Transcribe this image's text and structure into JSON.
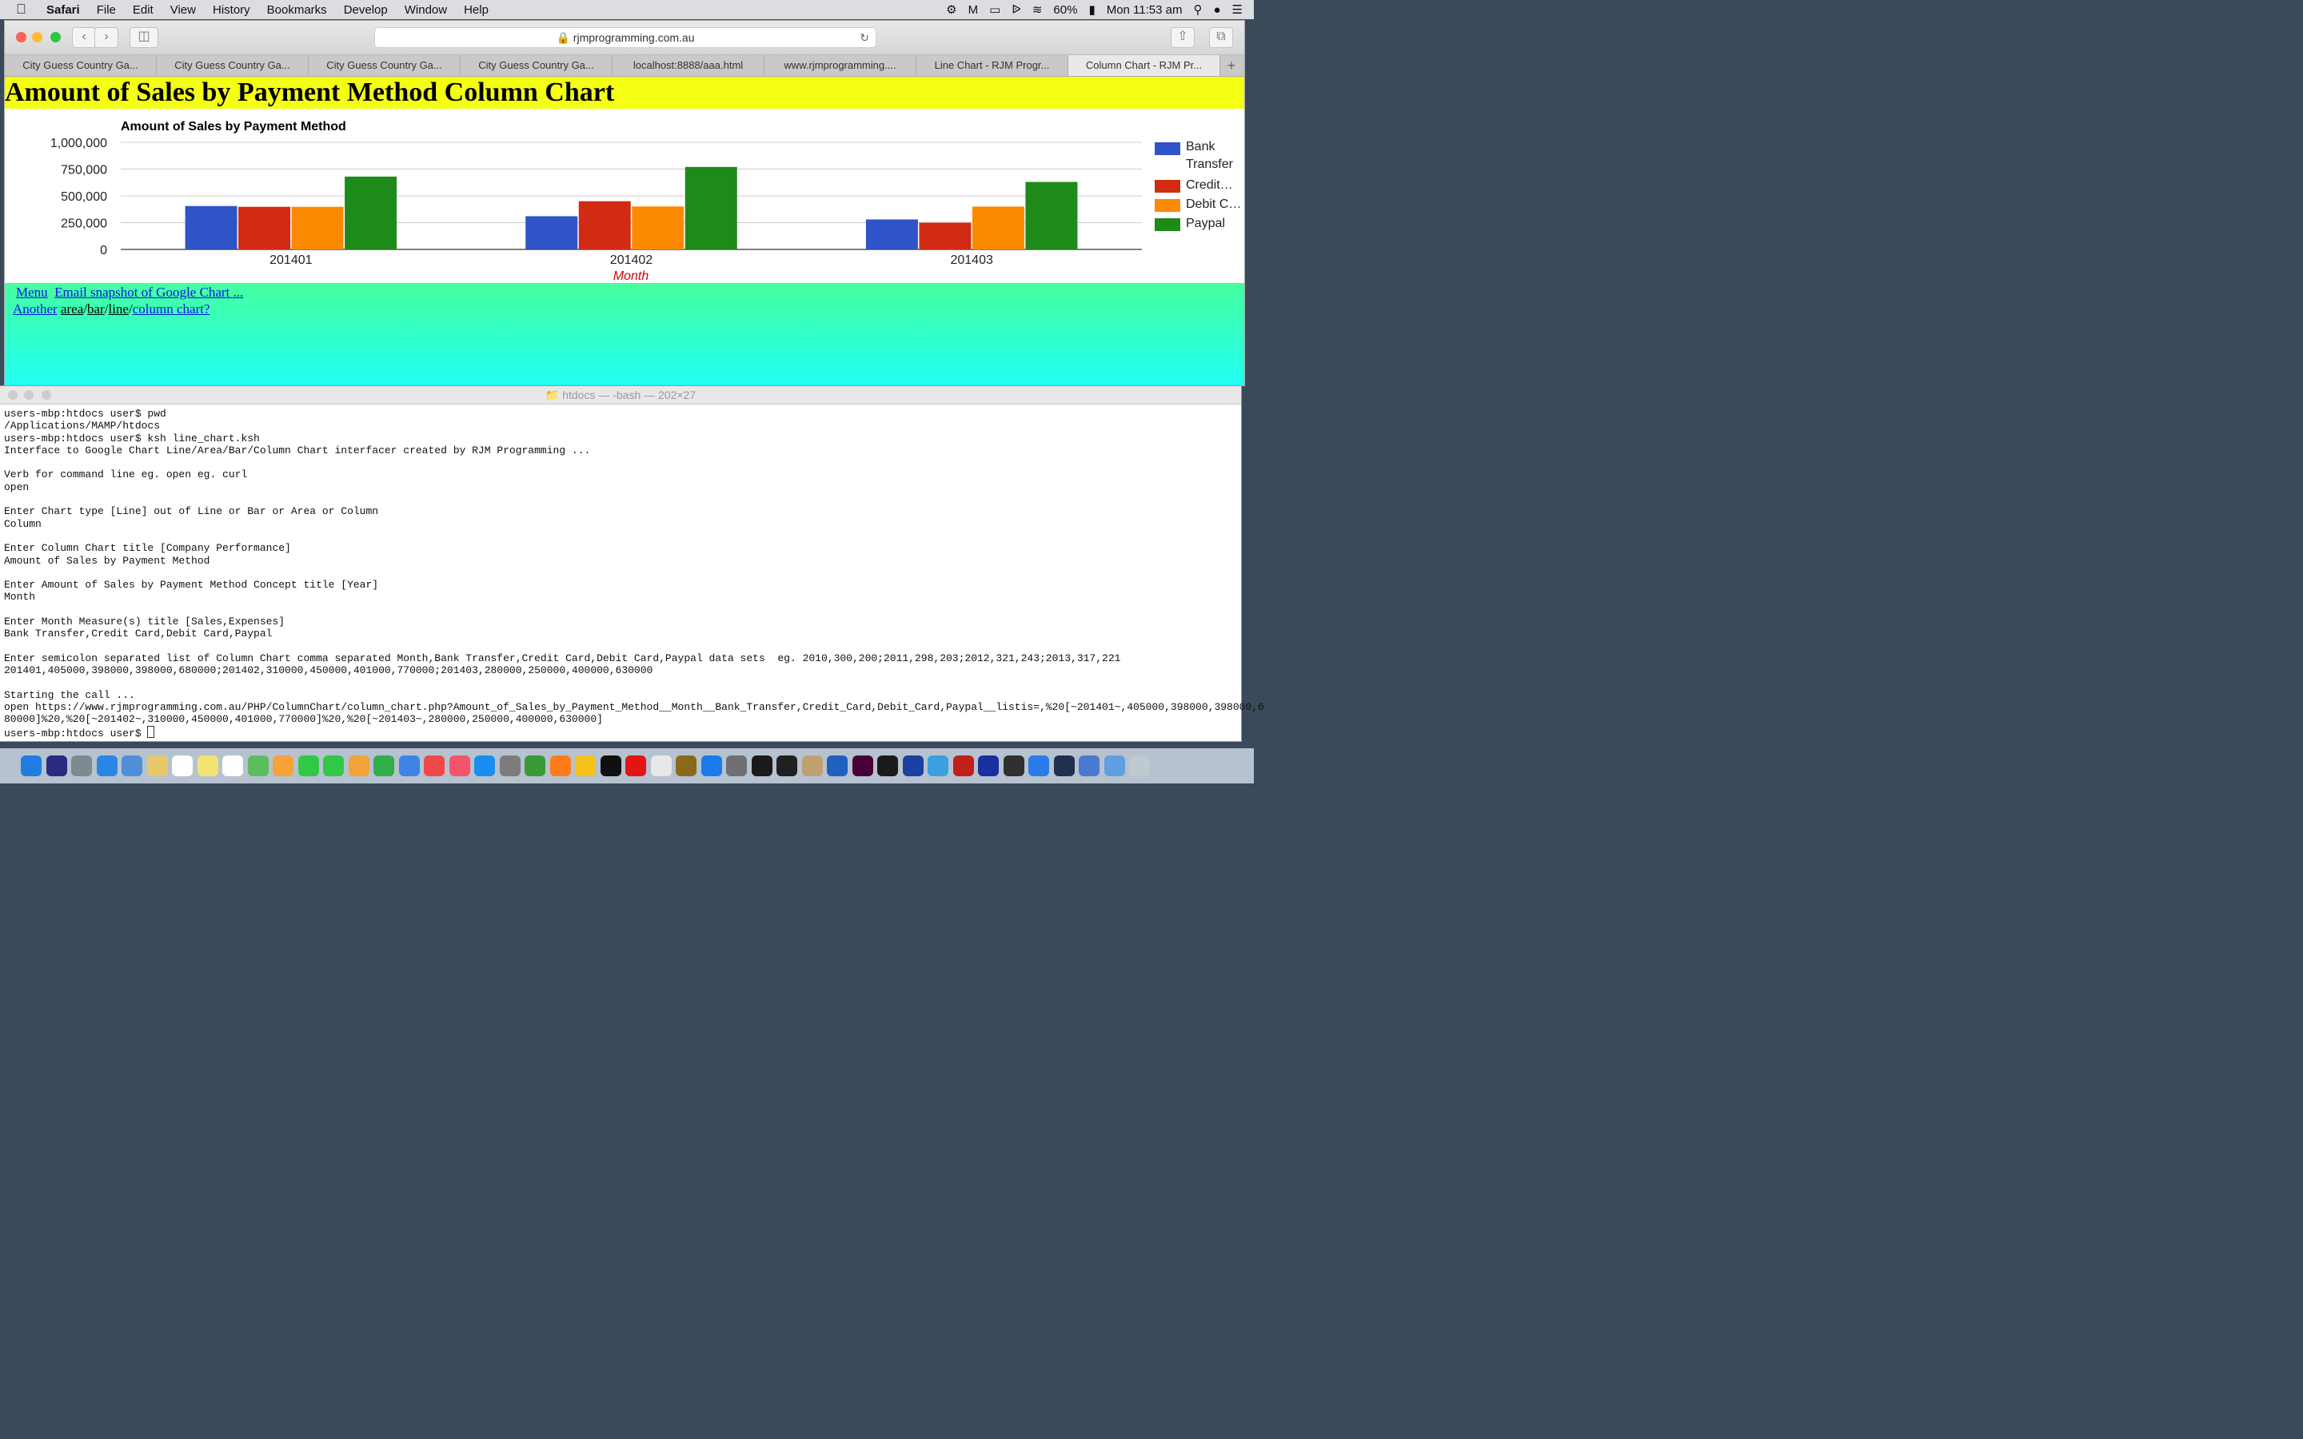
{
  "menubar": {
    "app": "Safari",
    "items": [
      "File",
      "Edit",
      "View",
      "History",
      "Bookmarks",
      "Develop",
      "Window",
      "Help"
    ],
    "battery": "60%",
    "clock": "Mon 11:53 am"
  },
  "safari": {
    "url": "rjmprogramming.com.au",
    "tabs": [
      "City Guess Country Ga...",
      "City Guess Country Ga...",
      "City Guess Country Ga...",
      "City Guess Country Ga...",
      "localhost:8888/aaa.html",
      "www.rjmprogramming....",
      "Line Chart - RJM Progr...",
      "Column Chart - RJM Pr..."
    ],
    "page_title": "Amount of Sales by Payment Method Column Chart",
    "links": {
      "menu": "Menu",
      "email": "Email snapshot of Google Chart ...",
      "another": "Another",
      "area": "area",
      "bar": "bar",
      "line": "line",
      "column": "column chart?"
    }
  },
  "chart_data": {
    "type": "bar",
    "title": "Amount of Sales by Payment Method",
    "xlabel": "Month",
    "ylabel": "",
    "categories": [
      "201401",
      "201402",
      "201403"
    ],
    "series": [
      {
        "name": "Bank Transfer",
        "values": [
          405000,
          310000,
          280000
        ],
        "color": "#2f54c7"
      },
      {
        "name": "Credit…",
        "values": [
          398000,
          450000,
          250000
        ],
        "color": "#d22b14"
      },
      {
        "name": "Debit C…",
        "values": [
          398000,
          401000,
          400000
        ],
        "color": "#fb8a02"
      },
      {
        "name": "Paypal",
        "values": [
          680000,
          770000,
          630000
        ],
        "color": "#1e8a1a"
      }
    ],
    "ylim": [
      0,
      1000000
    ],
    "yticks": [
      0,
      250000,
      500000,
      750000,
      1000000
    ],
    "ytick_labels": [
      "0",
      "250,000",
      "500,000",
      "750,000",
      "1,000,000"
    ],
    "legend": "right"
  },
  "terminal": {
    "title": "htdocs — -bash — 202×27",
    "lines": [
      "users-mbp:htdocs user$ pwd",
      "/Applications/MAMP/htdocs",
      "users-mbp:htdocs user$ ksh line_chart.ksh",
      "Interface to Google Chart Line/Area/Bar/Column Chart interfacer created by RJM Programming ...",
      "",
      "Verb for command line eg. open eg. curl",
      "open",
      "",
      "Enter Chart type [Line] out of Line or Bar or Area or Column",
      "Column",
      "",
      "Enter Column Chart title [Company Performance]",
      "Amount of Sales by Payment Method",
      "",
      "Enter Amount of Sales by Payment Method Concept title [Year]",
      "Month",
      "",
      "Enter Month Measure(s) title [Sales,Expenses]",
      "Bank Transfer,Credit Card,Debit Card,Paypal",
      "",
      "Enter semicolon separated list of Column Chart comma separated Month,Bank Transfer,Credit Card,Debit Card,Paypal data sets  eg. 2010,300,200;2011,298,203;2012,321,243;2013,317,221",
      "201401,405000,398000,398000,680000;201402,310000,450000,401000,770000;201403,280000,250000,400000,630000",
      "",
      "Starting the call ...",
      "open https://www.rjmprogramming.com.au/PHP/ColumnChart/column_chart.php?Amount_of_Sales_by_Payment_Method__Month__Bank_Transfer,Credit_Card,Debit_Card,Paypal__listis=,%20[~201401~,405000,398000,398000,6",
      "80000]%20,%20[~201402~,310000,450000,401000,770000]%20,%20[~201403~,280000,250000,400000,630000]"
    ],
    "prompt": "users-mbp:htdocs user$ "
  },
  "dock": {
    "icons": [
      "finder-icon",
      "siri-icon",
      "launchpad-icon",
      "safari-icon",
      "preview-icon",
      "notes-icon",
      "calendar-icon",
      "stickies-icon",
      "reminders-icon",
      "maps-icon",
      "photos-icon",
      "messages-icon",
      "facetime-icon",
      "pages-icon",
      "numbers-icon",
      "keynote-icon",
      "news-icon",
      "music-icon",
      "appstore-icon",
      "systemprefs-icon",
      "anaconda-icon",
      "firefox-icon",
      "chrome-icon",
      "phpstorm-icon",
      "opera-icon",
      "tableplus-icon",
      "mamp-icon",
      "xcode-icon",
      "automator-icon",
      "terminal-icon",
      "inkscape-icon",
      "cyberduck-icon",
      "r-icon",
      "xd-icon",
      "chatgpt-icon",
      "filemaker-icon",
      "safari-tech-icon",
      "filezilla-icon",
      "audacity-icon",
      "font-icon",
      "quicktime-icon",
      "textmate-icon",
      "finder-folder-icon",
      "downloads-icon",
      "trash-icon"
    ],
    "colors": [
      "#1f7de0",
      "#2a2a80",
      "#808890",
      "#2a86e6",
      "#4e8fd8",
      "#e8c86a",
      "#ffffff",
      "#f4e273",
      "#ffffff",
      "#5bbd5b",
      "#f6a23a",
      "#33c748",
      "#33c748",
      "#f3a23a",
      "#2fae4a",
      "#3e84e4",
      "#f04848",
      "#f6546a",
      "#1a8ef0",
      "#7c7c7c",
      "#3a9a3a",
      "#ff7b1b",
      "#f4c21b",
      "#101010",
      "#e21414",
      "#e8e8e8",
      "#8a6a1a",
      "#1a7ae8",
      "#707070",
      "#1a1a1a",
      "#202020",
      "#c0a070",
      "#2060c0",
      "#470137",
      "#1a1a1a",
      "#1a40a0",
      "#3aa0e0",
      "#c0201a",
      "#1a30a0",
      "#303030",
      "#2a7ae8",
      "#203050",
      "#4a7ad0",
      "#60a0e0",
      "#c0c8d0"
    ]
  }
}
